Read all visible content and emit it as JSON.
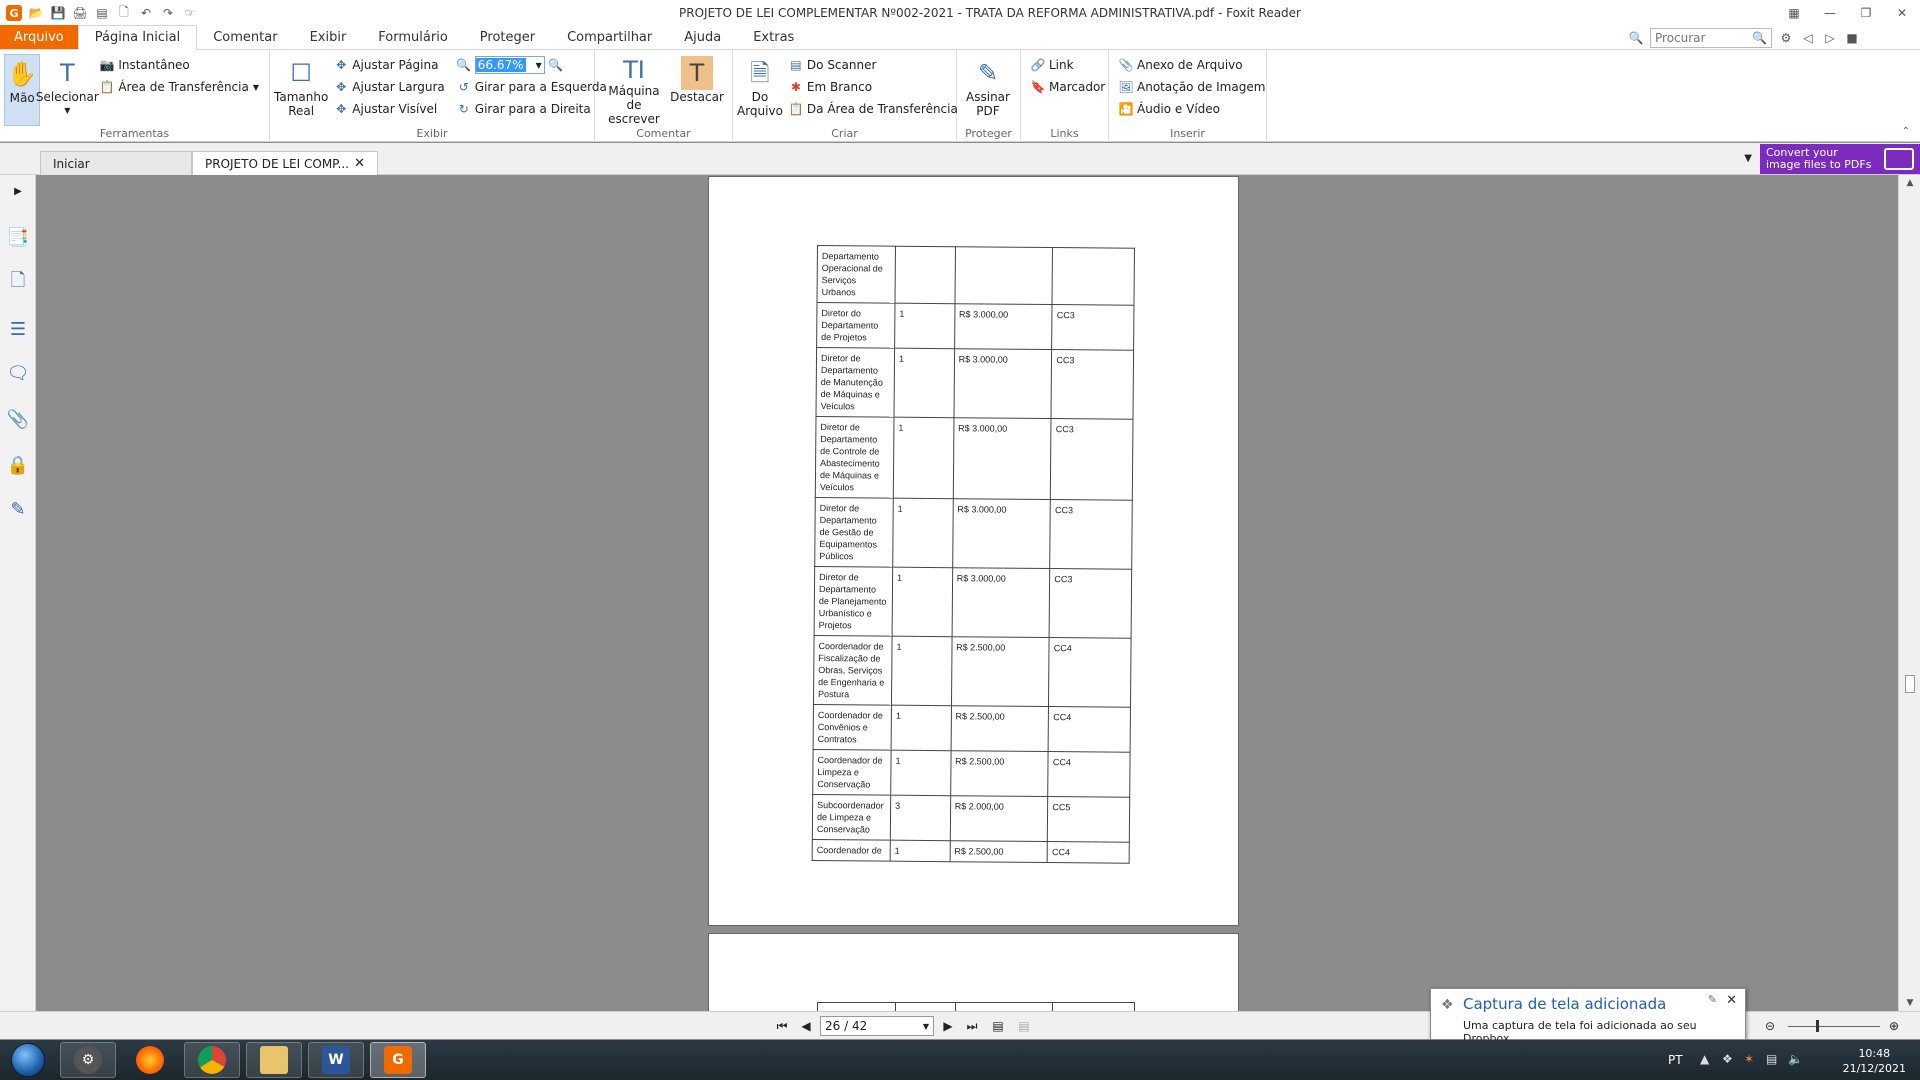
{
  "window": {
    "title": "PROJETO DE LEI COMPLEMENTAR Nº002-2021 - TRATA DA REFORMA ADMINISTRATIVA.pdf - Foxit Reader"
  },
  "menu": {
    "tabs": [
      "Arquivo",
      "Página Inicial",
      "Comentar",
      "Exibir",
      "Formulário",
      "Proteger",
      "Compartilhar",
      "Ajuda",
      "Extras"
    ],
    "search_placeholder": "Procurar"
  },
  "ribbon": {
    "ferramentas": {
      "label": "Ferramentas",
      "mao": "Mão",
      "selecionar": "Selecionar",
      "instantaneo": "Instantâneo",
      "area_transferencia": "Área de Transferência"
    },
    "exibir": {
      "label": "Exibir",
      "tamanho_real": "Tamanho Real",
      "ajustar_pagina": "Ajustar Página",
      "ajustar_largura": "Ajustar Largura",
      "ajustar_visivel": "Ajustar Visível",
      "zoom": "66.67%",
      "girar_esquerda": "Girar para a Esquerda",
      "girar_direita": "Girar para a Direita"
    },
    "comentar": {
      "label": "Comentar",
      "maquina": "Máquina de escrever",
      "destacar": "Destacar"
    },
    "criar": {
      "label": "Criar",
      "do_arquivo": "Do Arquivo",
      "do_scanner": "Do Scanner",
      "em_branco": "Em Branco",
      "da_area": "Da Área de Transferência"
    },
    "proteger": {
      "label": "Proteger",
      "assinar": "Assinar PDF"
    },
    "links": {
      "label": "Links",
      "link": "Link",
      "marcador": "Marcador"
    },
    "inserir": {
      "label": "Inserir",
      "anexo": "Anexo de Arquivo",
      "anotacao": "Anotação de Imagem",
      "audio": "Áudio e Vídeo"
    }
  },
  "doc_tabs": {
    "start": "Iniciar",
    "doc": "PROJETO DE LEI COMP..."
  },
  "ad": {
    "line1": "Convert your",
    "line2": "image files to PDFs"
  },
  "table_rows": [
    {
      "cargo": "Departamento Operacional de Serviços Urbanos",
      "qtd": "",
      "valor": "",
      "simbolo": ""
    },
    {
      "cargo": "Diretor do Departamento de Projetos",
      "qtd": "1",
      "valor": "R$ 3.000,00",
      "simbolo": "CC3"
    },
    {
      "cargo": "Diretor de Departamento de Manutenção de Máquinas e Veículos",
      "qtd": "1",
      "valor": "R$ 3.000,00",
      "simbolo": "CC3"
    },
    {
      "cargo": "Diretor de Departamento de Controle de Abastecimento de Máquinas e Veículos",
      "qtd": "1",
      "valor": "R$ 3.000,00",
      "simbolo": "CC3"
    },
    {
      "cargo": "Diretor de Departamento de Gestão de Equipamentos Públicos",
      "qtd": "1",
      "valor": "R$ 3.000,00",
      "simbolo": "CC3"
    },
    {
      "cargo": "Diretor de Departamento de Planejamento Urbanístico e Projetos",
      "qtd": "1",
      "valor": "R$ 3.000,00",
      "simbolo": "CC3"
    },
    {
      "cargo": "Coordenador de Fiscalização de Obras, Serviços de Engenharia e Postura",
      "qtd": "1",
      "valor": "R$ 2.500,00",
      "simbolo": "CC4"
    },
    {
      "cargo": "Coordenador de Convênios e Contratos",
      "qtd": "1",
      "valor": "R$ 2.500,00",
      "simbolo": "CC4"
    },
    {
      "cargo": "Coordenador de Limpeza e Conservação",
      "qtd": "1",
      "valor": "R$ 2.500,00",
      "simbolo": "CC4"
    },
    {
      "cargo": "Subcoordenador de Limpeza e Conservação",
      "qtd": "3",
      "valor": "R$ 2.000,00",
      "simbolo": "CC5"
    },
    {
      "cargo": "Coordenador de",
      "qtd": "1",
      "valor": "R$ 2.500,00",
      "simbolo": "CC4"
    }
  ],
  "status": {
    "page": "26 / 42"
  },
  "toast": {
    "title": "Captura de tela adicionada",
    "message": "Uma captura de tela foi adicionada ao seu Dropbox."
  },
  "taskbar": {
    "lang": "PT",
    "time": "10:48",
    "date": "21/12/2021"
  },
  "colors": {
    "accent": "#f06a00",
    "ad_bg": "#7b2cbf",
    "link_blue": "#1f5fbf"
  }
}
